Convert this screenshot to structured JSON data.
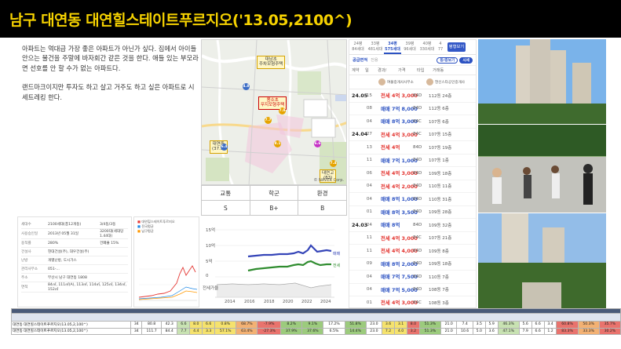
{
  "title": "남구 대연동 대연힐스테이트푸르지오('13.05,2100^)",
  "description": [
    "아파트는 역대급 가장 좋은 아파트가 아닌가 싶다. 집에서 아이들 안으는 물건을 주말에 바자회간 같은 것을 한다. 애들 있는 부모라면 선호를 안 할 수가 없는 아파트다.",
    "랜드마크이지만 투자도 하고 살고 거주도 하고 싶은 아파트로 시세트레킹 한다."
  ],
  "map": {
    "labels": [
      {
        "text": "대남초\n주차모형주택",
        "red": false
      },
      {
        "text": "용소초\n무지모형주택",
        "red": true
      },
      {
        "text": "대연중\n(37.5)",
        "red": false
      },
      {
        "text": "대연고\n(83)",
        "red": false
      }
    ],
    "dots": [
      "4.8",
      "7.7",
      "7.9",
      "6.4",
      "8.1",
      "6.6",
      "7.4"
    ],
    "credit": "© NAVER Corp."
  },
  "ratings": {
    "headers": [
      "교통",
      "학군",
      "환경"
    ],
    "values": [
      "S",
      "B+",
      "B"
    ]
  },
  "info_card": {
    "rows": [
      {
        "k": "세대수",
        "v": "2100세대(총12개동)",
        "v2": "3/4동/3동"
      },
      {
        "k": "사용승인일",
        "v": "2013년 05월 31일",
        "v2": "3200대(세대당 1.44대)"
      },
      {
        "k": "용적률",
        "v": "280%",
        "v2": "건폐율 15%"
      },
      {
        "k": "건설사",
        "v": "현대건설(주), 대우건설(주)",
        "v2": ""
      },
      {
        "k": "난방",
        "v": "개별난방, 도시가스",
        "v2": ""
      },
      {
        "k": "관리사무소",
        "v": "051-...",
        "v2": ""
      },
      {
        "k": "주소",
        "v": "부산시 남구 대연동 1808",
        "v2": ""
      },
      {
        "k": "면적",
        "v": "84㎡, 111㎡(A), 113㎡, 114㎡, 125㎡, 134㎡, 152㎡",
        "v2": ""
      }
    ]
  },
  "mini_chart": {
    "legend": [
      "대연힐스테이트푸르지오",
      "전국평균",
      "남구평균"
    ]
  },
  "price_chart": {
    "ylabels": [
      "15억",
      "10억",
      "5억",
      "0"
    ],
    "xlabels": [
      "2014",
      "2016",
      "2018",
      "2020",
      "2022",
      "2024"
    ],
    "legend_sale": "매매",
    "legend_jeonse": "전세",
    "bottom_label": "전세가율"
  },
  "tx_panel": {
    "tabs": [
      {
        "top": "24평",
        "bottom": "84세대"
      },
      {
        "top": "33평",
        "bottom": "481세대"
      },
      {
        "top": "34평",
        "bottom": "575세대"
      },
      {
        "top": "39평",
        "bottom": "96세대"
      },
      {
        "top": "40평",
        "bottom": "330세대"
      },
      {
        "top": "4",
        "bottom": "77"
      }
    ],
    "active_tab": 2,
    "tab_button": "평형보기",
    "filter_active": "공급면적",
    "filter_muted": "전용",
    "pill1": "동/층보기",
    "pill2": "시세",
    "header": [
      "계약",
      "일",
      "경과/",
      "가격",
      "타입",
      "거래동"
    ],
    "agents": [
      "여불중개사사무소",
      "현신스타공인중개사"
    ],
    "rows": [
      {
        "month": "24.05",
        "day": "15",
        "type": "전세",
        "price": "4억 3,000",
        "area": "84D",
        "floor": "112동 24층"
      },
      {
        "month": "",
        "day": "08",
        "type": "매매",
        "price": "7억 8,000",
        "area": "84D",
        "floor": "112동 6층"
      },
      {
        "month": "",
        "day": "04",
        "type": "매매",
        "price": "8억 3,000",
        "area": "84C",
        "floor": "107동 6층"
      },
      {
        "month": "24.04",
        "day": "27",
        "type": "전세",
        "price": "4억 3,000",
        "area": "84C",
        "floor": "107동 15층"
      },
      {
        "month": "",
        "day": "13",
        "type": "전세",
        "price": "4억",
        "area": "84D",
        "floor": "107동 19층"
      },
      {
        "month": "",
        "day": "11",
        "type": "매매",
        "price": "7억 1,000",
        "area": "84D",
        "floor": "107동 1층"
      },
      {
        "month": "",
        "day": "06",
        "type": "전세",
        "price": "4억 3,000",
        "area": "84D",
        "floor": "109동 18층"
      },
      {
        "month": "",
        "day": "04",
        "type": "전세",
        "price": "4억 2,000",
        "area": "84D",
        "floor": "110동 11층"
      },
      {
        "month": "",
        "day": "04",
        "type": "매매",
        "price": "8억 1,000",
        "area": "84D",
        "floor": "110동 31층"
      },
      {
        "month": "",
        "day": "01",
        "type": "매매",
        "price": "8억 3,500",
        "area": "84D",
        "floor": "109동 28층"
      },
      {
        "month": "24.03",
        "day": "24",
        "type": "매매",
        "price": "8억",
        "area": "84D",
        "floor": "109동 32층"
      },
      {
        "month": "",
        "day": "11",
        "type": "전세",
        "price": "4억 3,000",
        "area": "84C",
        "floor": "107동 21층"
      },
      {
        "month": "",
        "day": "11",
        "type": "전세",
        "price": "4억 4,000",
        "area": "84D",
        "floor": "109동 8층"
      },
      {
        "month": "",
        "day": "09",
        "type": "매매",
        "price": "8억 2,000",
        "area": "84D",
        "floor": "109동 18층"
      },
      {
        "month": "",
        "day": "04",
        "type": "매매",
        "price": "7억 7,500",
        "area": "84D",
        "floor": "110동 7층"
      },
      {
        "month": "",
        "day": "04",
        "type": "매매",
        "price": "7억 5,000",
        "area": "84D",
        "floor": "108동 7층"
      },
      {
        "month": "",
        "day": "01",
        "type": "전세",
        "price": "4억 3,000",
        "area": "84C",
        "floor": "108동 3층"
      }
    ]
  },
  "stats": {
    "rows": [
      {
        "name": "대연동 대연힐스테이트푸르지오(13.05,2,100^)",
        "cells": [
          "34",
          "80.8",
          "42.3",
          "6.6",
          "8.0",
          "6.6",
          "0.8%",
          "68.7%",
          "-7.9%",
          "8.2%",
          "9.1%",
          "17.2%",
          "51.8%",
          "23.0",
          "3.6",
          "3.1",
          "8.0",
          "51.3%",
          "21.0",
          "7.4",
          "3.5",
          "5.9",
          "46.3%",
          "5.6",
          "6.6",
          "3.4",
          "60.8%",
          "50.3%",
          "35.7%"
        ]
      },
      {
        "name": "대연동 대연힐스테이트푸르지오(13.05,2,100^)",
        "cells": [
          "34",
          "111.7",
          "84.4",
          "7.7",
          "4.4",
          "3.3",
          "57.1%",
          "63.4%",
          "-27.3%",
          "37.9%",
          "37.6%",
          "6.5%",
          "14.4%",
          "23.0",
          "7.2",
          "4.0",
          "3.2",
          "51.3%",
          "21.0",
          "10.6",
          "5.0",
          "3.6",
          "47.1%",
          "7.9",
          "6.6",
          "1.2",
          "83.3%",
          "33.3%",
          "30.2%"
        ]
      }
    ]
  }
}
